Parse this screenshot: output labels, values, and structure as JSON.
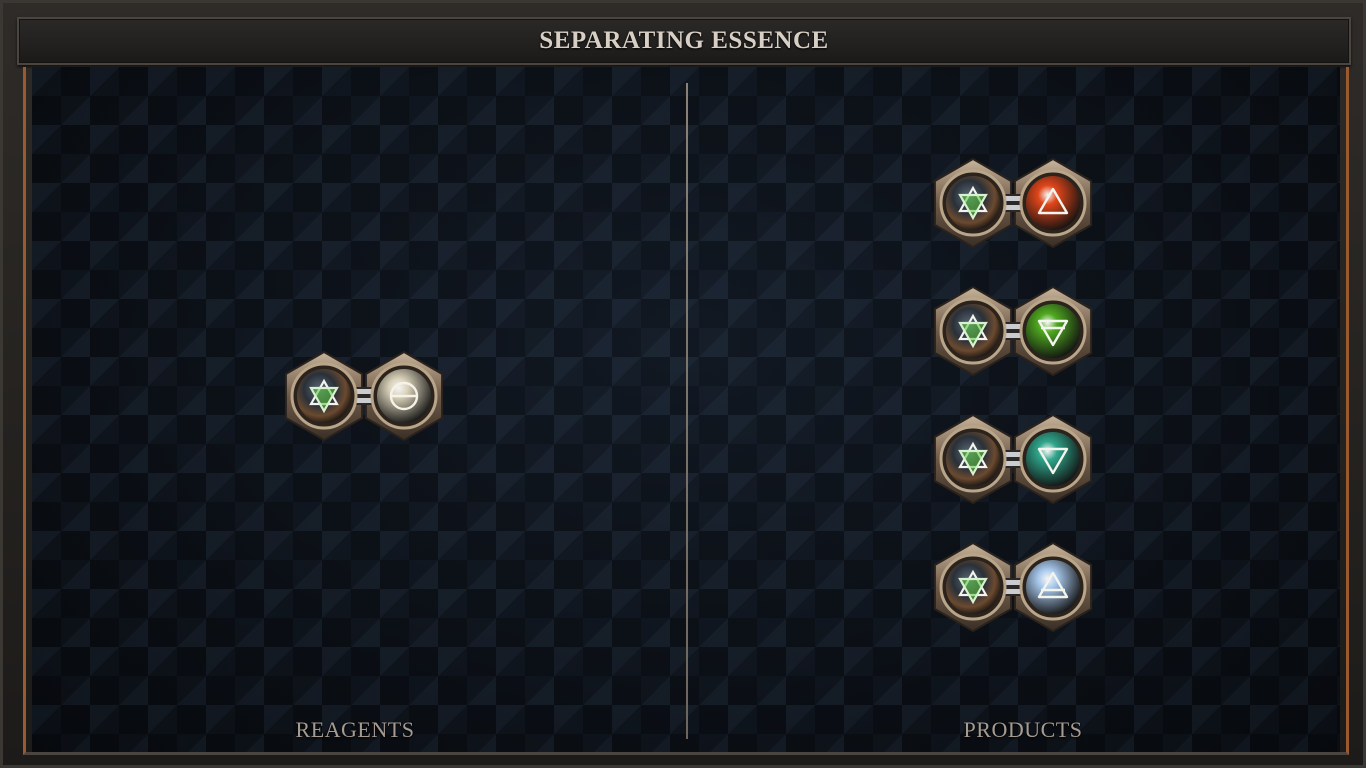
{
  "window": {
    "title": "SEPARATING ESSENCE"
  },
  "reagents": {
    "label": "REAGENTS",
    "items": [
      {
        "left_icon": "fire-water-element-icon",
        "right_icon": "salt-theta-icon",
        "right_color": "#d8d0b8"
      }
    ]
  },
  "products": {
    "label": "PRODUCTS",
    "items": [
      {
        "left_icon": "fire-water-element-icon",
        "right_icon": "fire-triangle-icon",
        "right_color": "#e0461a"
      },
      {
        "left_icon": "fire-water-element-icon",
        "right_icon": "earth-triangle-icon",
        "right_color": "#4fa81f"
      },
      {
        "left_icon": "fire-water-element-icon",
        "right_icon": "water-triangle-icon",
        "right_color": "#2fa58a"
      },
      {
        "left_icon": "fire-water-element-icon",
        "right_icon": "air-triangle-icon",
        "right_color": "#a8c8ec"
      }
    ]
  },
  "colors": {
    "border_accent": "#9a5a2f",
    "title_text": "#d8cfc4",
    "label_text": "#a59b90",
    "background": "#10161f"
  }
}
